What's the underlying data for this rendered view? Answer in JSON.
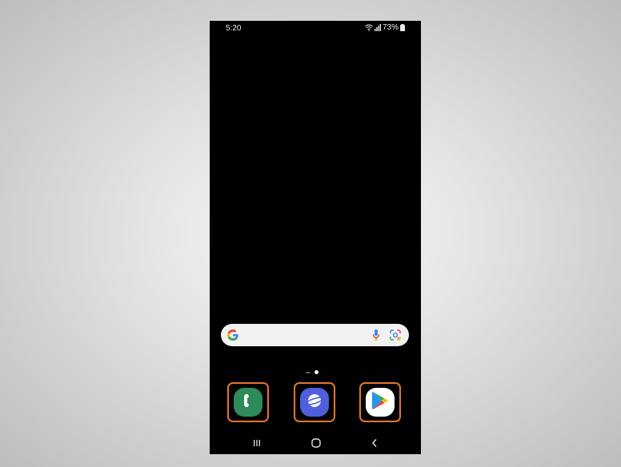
{
  "status_bar": {
    "time": "5:20",
    "battery_percent": "73%",
    "icons": [
      "wifi-icon",
      "signal-icon",
      "battery-icon"
    ]
  },
  "search_bar": {
    "icons": [
      "google-g-icon",
      "microphone-icon",
      "google-lens-icon"
    ]
  },
  "home_pages": {
    "count": 2,
    "current": 2
  },
  "dock": {
    "apps": [
      {
        "name": "phone",
        "icon": "phone-icon",
        "color": "#2e8b57"
      },
      {
        "name": "internet",
        "icon": "planet-icon",
        "color": "#4f5fdc"
      },
      {
        "name": "play-store",
        "icon": "play-store-icon",
        "color": "#ffffff"
      }
    ],
    "highlight_color": "#e4762b"
  },
  "nav_bar": {
    "buttons": [
      "recents-icon",
      "home-icon",
      "back-icon"
    ]
  }
}
